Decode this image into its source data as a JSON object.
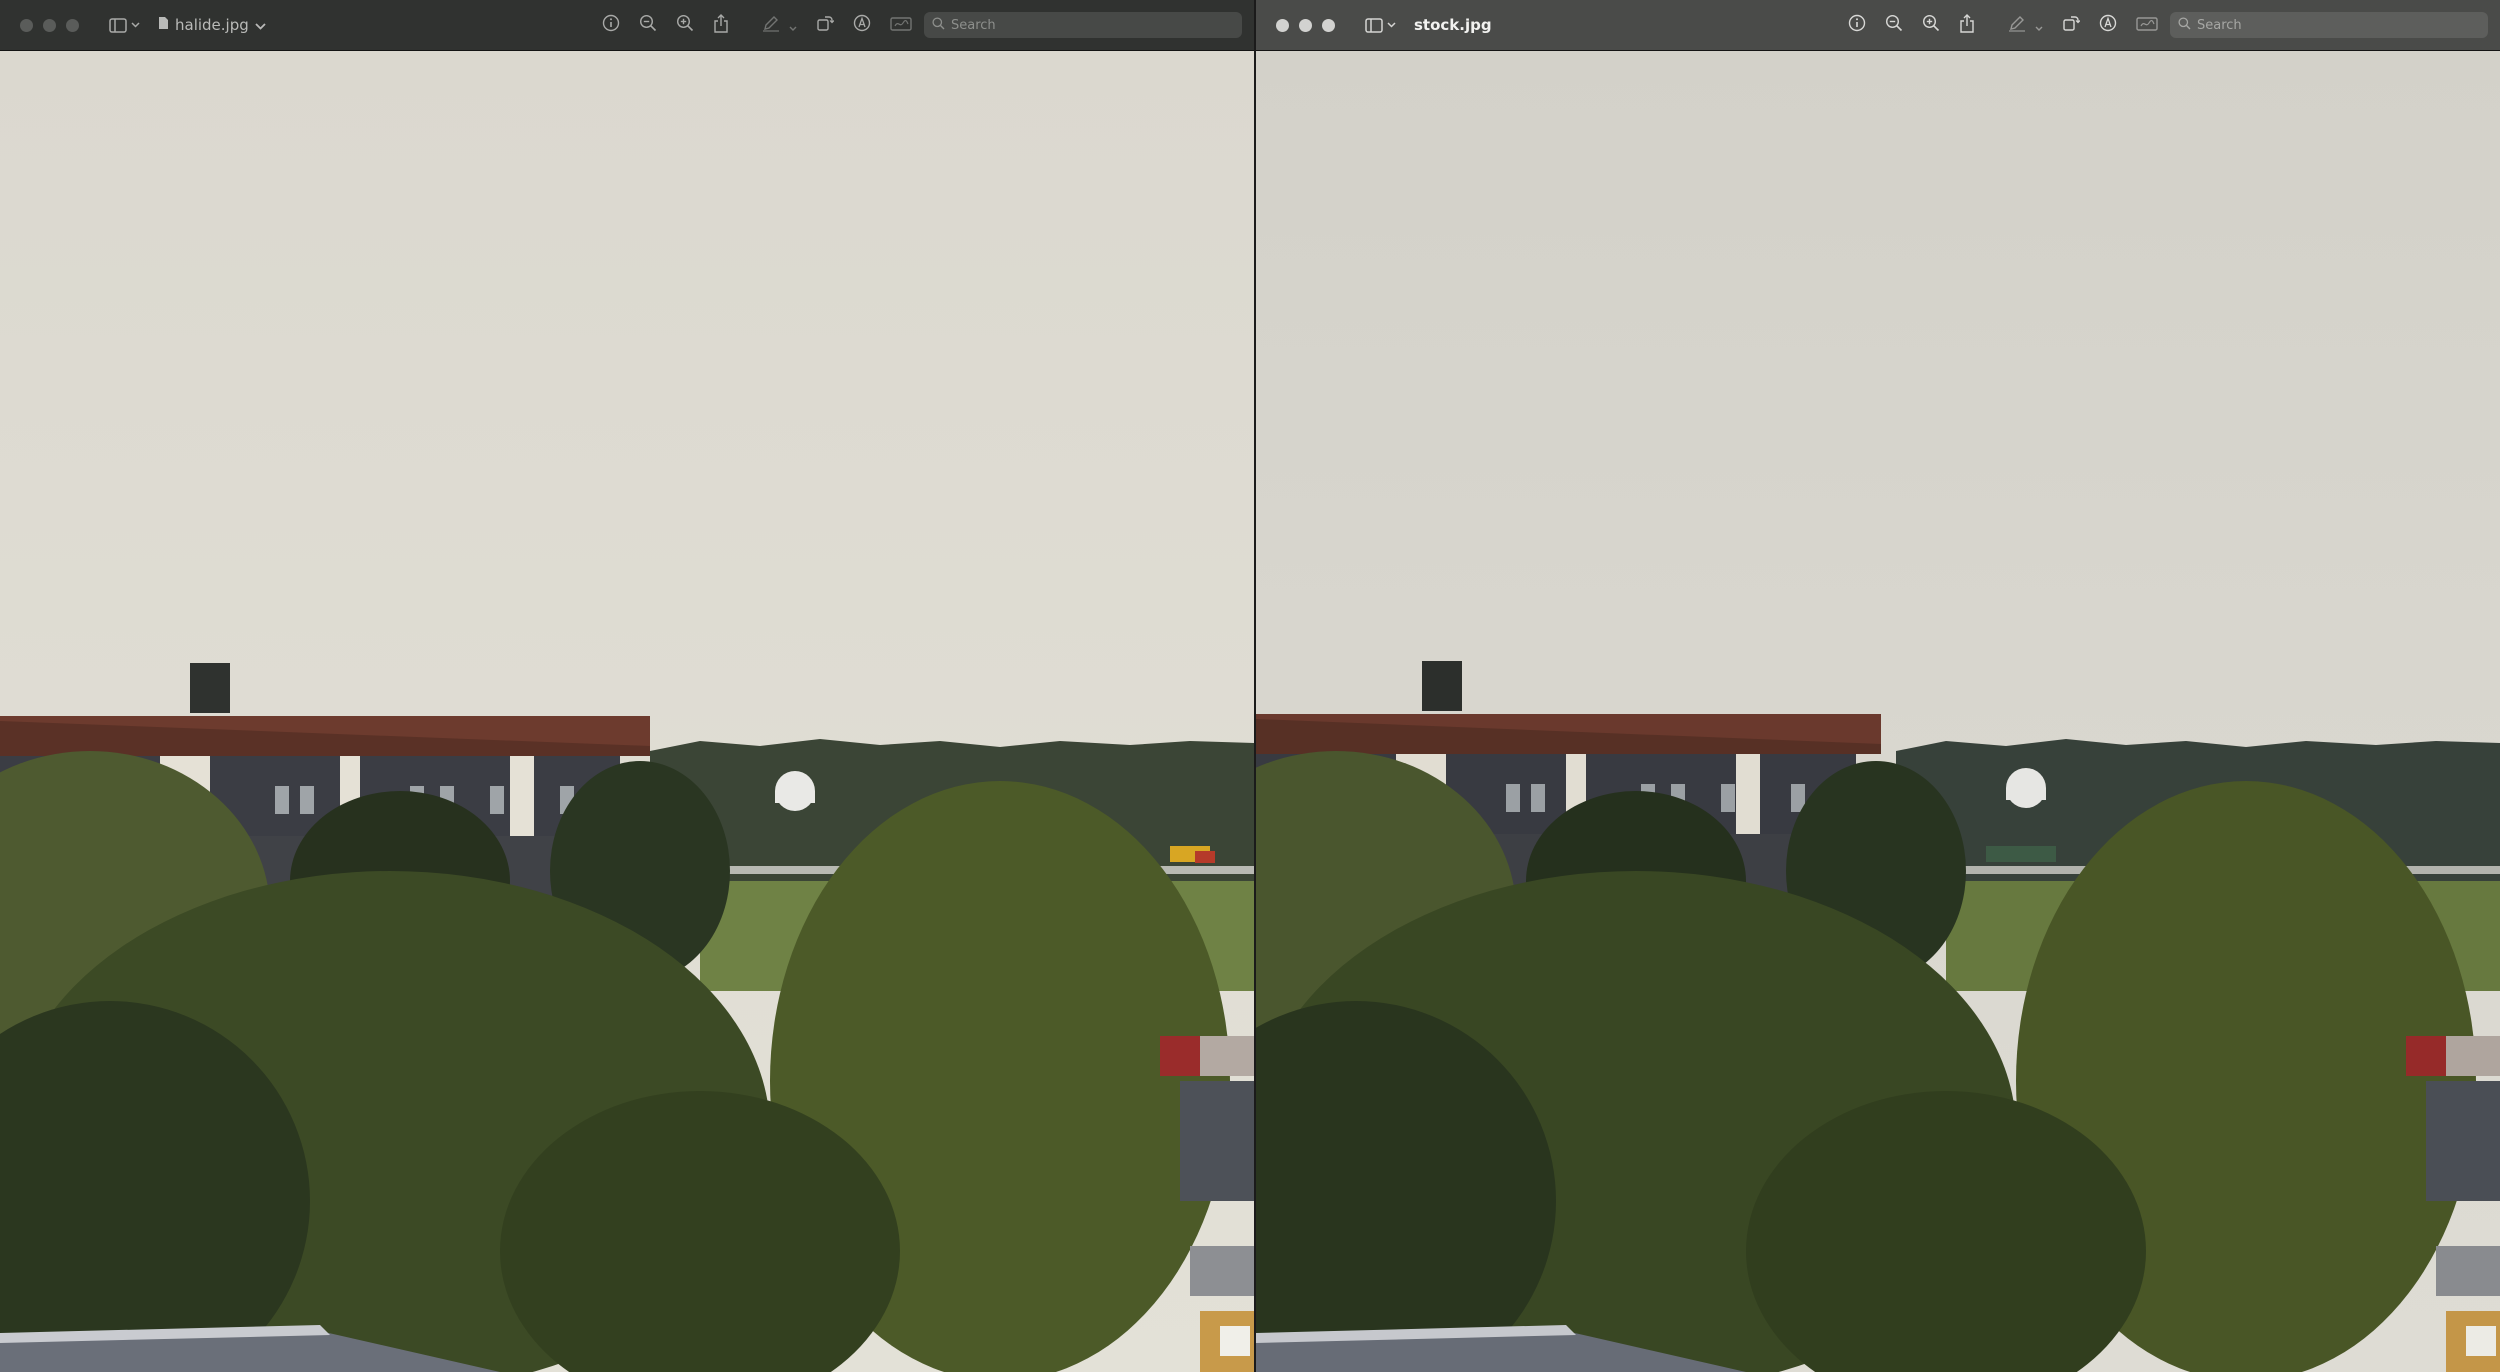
{
  "windows": {
    "left": {
      "filename": "halide.jpg",
      "search_placeholder": "Search"
    },
    "right": {
      "filename": "stock.jpg",
      "search_placeholder": "Search"
    }
  },
  "icons": {
    "traffic_lights": [
      "close-dot",
      "minimize-dot",
      "zoom-dot"
    ],
    "toolbar": [
      "sidebar-icon",
      "chevron-down-icon",
      "document-icon",
      "info-icon",
      "zoom-out-icon",
      "zoom-in-icon",
      "share-icon",
      "markup-pen-icon",
      "rotate-icon",
      "markup-circle-icon",
      "signature-icon",
      "search-icon"
    ]
  },
  "colors": {
    "left_sky": "#d9d6cc",
    "right_sky": "#d4d2ca",
    "foliage_dark": "#2e3a1f",
    "foliage_light": "#55602e",
    "roof": "#6b3a2c"
  }
}
